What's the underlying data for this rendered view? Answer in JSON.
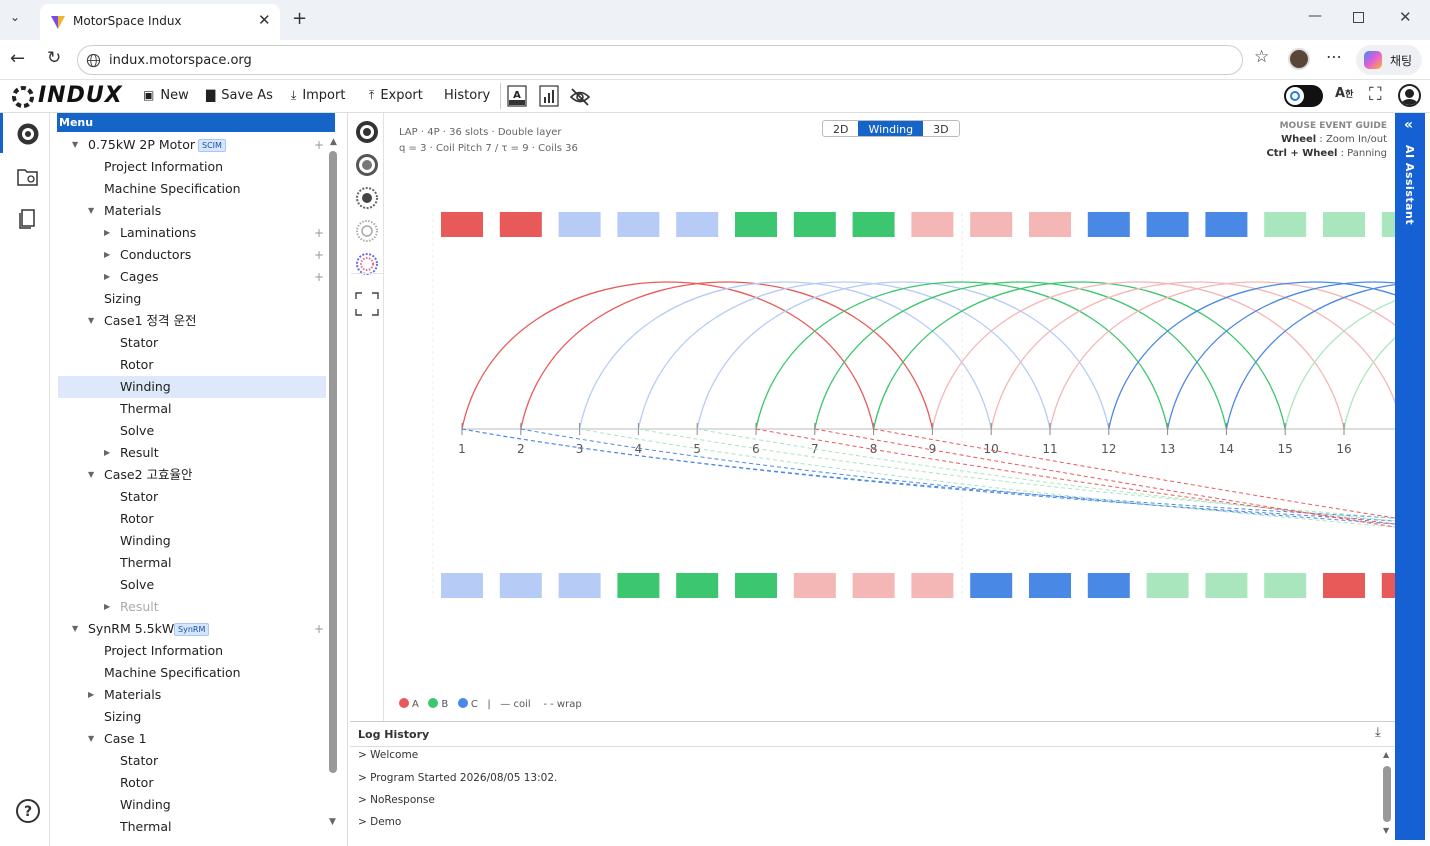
{
  "browser": {
    "tab_title": "MotorSpace Indux",
    "url": "indux.motorspace.org",
    "chat_label": "채팅"
  },
  "app": {
    "logo": "INDUX",
    "toolbar": {
      "new": "New",
      "save_as": "Save As",
      "import": "Import",
      "export": "Export",
      "history": "History"
    }
  },
  "tree": {
    "header": "Menu",
    "nodes": [
      {
        "label": "0.75kW 2P Motor",
        "badge": "SCIM"
      },
      {
        "label": "Project Information"
      },
      {
        "label": "Machine Specification"
      },
      {
        "label": "Materials"
      },
      {
        "label": "Laminations"
      },
      {
        "label": "Conductors"
      },
      {
        "label": "Cages"
      },
      {
        "label": "Sizing"
      },
      {
        "label": "Case1 정격 운전"
      },
      {
        "label": "Stator"
      },
      {
        "label": "Rotor"
      },
      {
        "label": "Winding"
      },
      {
        "label": "Thermal"
      },
      {
        "label": "Solve"
      },
      {
        "label": "Result"
      },
      {
        "label": "Case2 고효율안"
      },
      {
        "label": "Stator"
      },
      {
        "label": "Rotor"
      },
      {
        "label": "Winding"
      },
      {
        "label": "Thermal"
      },
      {
        "label": "Solve"
      },
      {
        "label": "Result"
      },
      {
        "label": "SynRM 5.5kW",
        "badge": "SynRM"
      },
      {
        "label": "Project Information"
      },
      {
        "label": "Machine Specification"
      },
      {
        "label": "Materials"
      },
      {
        "label": "Sizing"
      },
      {
        "label": "Case 1"
      },
      {
        "label": "Stator"
      },
      {
        "label": "Rotor"
      },
      {
        "label": "Winding"
      },
      {
        "label": "Thermal"
      }
    ]
  },
  "winding": {
    "info_line1": "LAP · 4P · 36 slots · Double layer",
    "info_line2": "q = 3 · Coil Pitch 7 / τ = 9 · Coils 36",
    "view_tabs": [
      "2D",
      "Winding",
      "3D"
    ],
    "active_view": "Winding",
    "guide_title": "MOUSE EVENT GUIDE",
    "guide_wheel_key": "Wheel",
    "guide_wheel_val": ": Zoom In/out",
    "guide_pan_key": "Ctrl + Wheel",
    "guide_pan_val": ": Panning",
    "slot_numbers": [
      "1",
      "2",
      "3",
      "4",
      "5",
      "6",
      "7",
      "8",
      "9",
      "10",
      "11",
      "12",
      "13",
      "14",
      "15",
      "16"
    ],
    "phase_colors": {
      "A": "#e85a5a",
      "B": "#3cc66f",
      "C": "#4a88e6"
    },
    "top_slots": [
      "A",
      "A",
      "-C",
      "-C",
      "-C",
      "B",
      "B",
      "B",
      "-A",
      "-A",
      "-A",
      "C",
      "C",
      "C",
      "-B",
      "-B",
      "-B"
    ],
    "bottom_slots": [
      "-C",
      "-C",
      "-C",
      "B",
      "B",
      "B",
      "-A",
      "-A",
      "-A",
      "C",
      "C",
      "C",
      "-B",
      "-B",
      "-B",
      "A",
      "A"
    ],
    "legend": {
      "a": "A",
      "b": "B",
      "c": "C",
      "sep": "|",
      "coil": "— coil",
      "wrap": "- - wrap"
    }
  },
  "log": {
    "title": "Log History",
    "lines": [
      "> Welcome",
      "> Program Started  2026/08/05 13:02.",
      "> NoResponse",
      "> Demo"
    ]
  },
  "ai": {
    "label": "AI Assistant"
  }
}
